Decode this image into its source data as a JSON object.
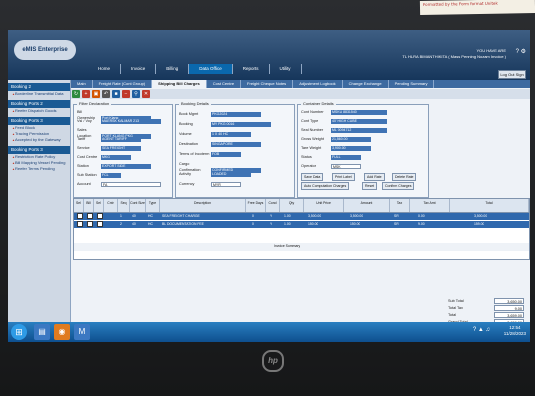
{
  "sticky_note": "Formatted by the Form format Unitek",
  "app": {
    "logo_text": "eMIS Enterprise",
    "user_line": "TL HLRA BIMANTHIKITA ( Mass Penning Nozam Invoice )",
    "user_top": "YOU HAVE ARE",
    "logout_label": "Log Out Sign"
  },
  "top_nav": [
    "Home",
    "Invoice",
    "Billing",
    "Data Office",
    "Reports",
    "Utility"
  ],
  "top_nav_active": 3,
  "sidebar": {
    "sections": [
      {
        "title": "Booking 2",
        "items": [
          "Borderline Transmittal Data"
        ]
      },
      {
        "title": "Booking Ports 2",
        "items": [
          "Reefer Dispatch Goods"
        ]
      },
      {
        "title": "Booking Ports 3",
        "items": [
          "Feed Block",
          "Tracing Permission",
          "Accepted by the Gateway"
        ]
      },
      {
        "title": "Booking Ports 3",
        "items": [
          "Restriction Rate Policy",
          "Bill Mapping Vessel Pending",
          "Reefer Terms Pending"
        ]
      }
    ]
  },
  "tabs": [
    "Main",
    "Freight Rate (Cont Group)",
    "Shipping Bill Charges",
    "Cost Centre",
    "Freight Cheque Notes",
    "Adjustment Logbook",
    "Change Exchange",
    "Pending Summary"
  ],
  "tabs_active": 2,
  "panel_left": {
    "title": "Filter Declaration",
    "rows": [
      {
        "label": "Bill Ownership",
        "value": "Port Klang"
      },
      {
        "label": "Vsl / Voy",
        "value": "MAERSK KALMAR 213"
      },
      {
        "label": "Sales Location",
        "value": "PORT KLANG PKG"
      },
      {
        "label": "Tariff",
        "value": "AGENT TARIFF"
      },
      {
        "label": "Service",
        "value": "SEA FREIGHT"
      },
      {
        "label": "Cost Centre",
        "value": "MKG"
      },
      {
        "label": "Station",
        "value": "EXPORT SIDE"
      },
      {
        "label": "Sub Station",
        "value": "FCL"
      },
      {
        "label": "Account",
        "value": "FA"
      }
    ]
  },
  "panel_mid": {
    "title": "Booking Details",
    "rows": [
      {
        "label": "Book Mgmt",
        "value": "PKG2024"
      },
      {
        "label": "Booking",
        "value": "MY PKG 0016"
      },
      {
        "label": "Volume",
        "value": "1 X 40 HC"
      },
      {
        "label": "Destination",
        "value": "SINGAPORE"
      },
      {
        "label": "Terms of Incoterm",
        "value": "FOB"
      },
      {
        "label": "Cargo Confirmation",
        "value": "CONFIRMED"
      },
      {
        "label": "Activity",
        "value": "LOADED"
      },
      {
        "label": "Currency",
        "value": "MYR"
      }
    ]
  },
  "panel_right": {
    "title": "Container Details",
    "rows": [
      {
        "label": "Cont Number",
        "value": "MSKU 8831540"
      },
      {
        "label": "Cont Type",
        "value": "40' HIGH CUBE"
      },
      {
        "label": "Seal Number",
        "value": "ML 0094712"
      },
      {
        "label": "Gross Weight",
        "value": "21,560.00"
      },
      {
        "label": "Tare Weight",
        "value": "3,900.00"
      },
      {
        "label": "Status",
        "value": "FULL"
      },
      {
        "label": "Operator",
        "value": "MSK"
      }
    ],
    "buttons": [
      "Save Data",
      "Print Label",
      "Add Rate",
      "Delete Rate",
      "Auto Computation Charges",
      "Reset",
      "Confirm Charges"
    ]
  },
  "grid": {
    "headers": [
      "Sel",
      "Bill",
      "Sel",
      "Cntr",
      "Seq",
      "Cont Size",
      "Type",
      "Description",
      "Free Days",
      "Cond",
      "Qty",
      "Unit Price",
      "Amount",
      "Tax",
      "Tax Amt",
      "Total"
    ],
    "rows": [
      [
        "",
        "",
        "",
        "",
        "1",
        "40",
        "HC",
        "SEA FREIGHT CHARGE",
        "0",
        "Y",
        "1.00",
        "3,500.00",
        "3,500.00",
        "SR",
        "0.00",
        "3,500.00"
      ],
      [
        "",
        "",
        "",
        "",
        "2",
        "40",
        "HC",
        "BL DOCUMENTATION FEE",
        "0",
        "Y",
        "1.00",
        "150.00",
        "150.00",
        "SR",
        "9.00",
        "159.00"
      ]
    ],
    "footer_label": "Invoice Summary"
  },
  "summary": [
    {
      "label": "Sub Total",
      "value": "3,650.00"
    },
    {
      "label": "Total Tax",
      "value": "9.00"
    },
    {
      "label": "Total",
      "value": "3,659.00"
    },
    {
      "label": "Grand Total",
      "value": "3,659.00"
    }
  ],
  "taskbar": {
    "time": "12:54",
    "date": "11/28/2023"
  },
  "brand": "hp"
}
